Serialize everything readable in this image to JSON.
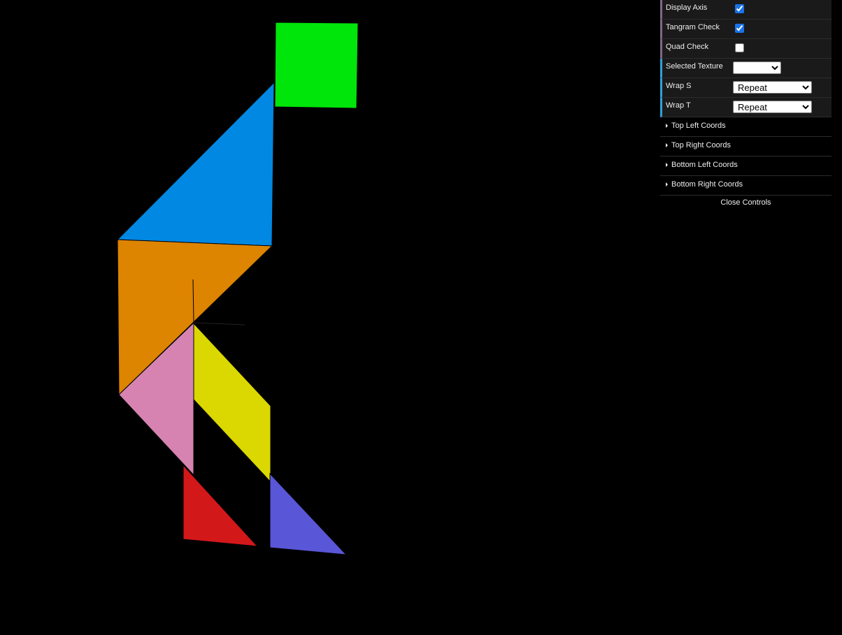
{
  "scene": {
    "pieces": [
      {
        "name": "square",
        "color": "#00e60a"
      },
      {
        "name": "large-triangle-blue",
        "color": "#0088e3"
      },
      {
        "name": "large-triangle-orange",
        "color": "#dd8400"
      },
      {
        "name": "medium-triangle-pink",
        "color": "#d683b2"
      },
      {
        "name": "parallelogram",
        "color": "#dad800"
      },
      {
        "name": "small-triangle-red",
        "color": "#d3181a"
      },
      {
        "name": "small-triangle-purple",
        "color": "#5a56d8"
      }
    ]
  },
  "controls": {
    "display_axis": {
      "label": "Display Axis",
      "checked": true
    },
    "tangram_check": {
      "label": "Tangram Check",
      "checked": true
    },
    "quad_check": {
      "label": "Quad Check",
      "checked": false
    },
    "selected_texture": {
      "label": "Selected Texture",
      "value": ""
    },
    "wrap_s": {
      "label": "Wrap S",
      "value": "Repeat"
    },
    "wrap_t": {
      "label": "Wrap T",
      "value": "Repeat"
    },
    "folders": {
      "top_left": "Top Left Coords",
      "top_right": "Top Right Coords",
      "bottom_left": "Bottom Left Coords",
      "bottom_right": "Bottom Right Coords"
    },
    "close_label": "Close Controls"
  }
}
